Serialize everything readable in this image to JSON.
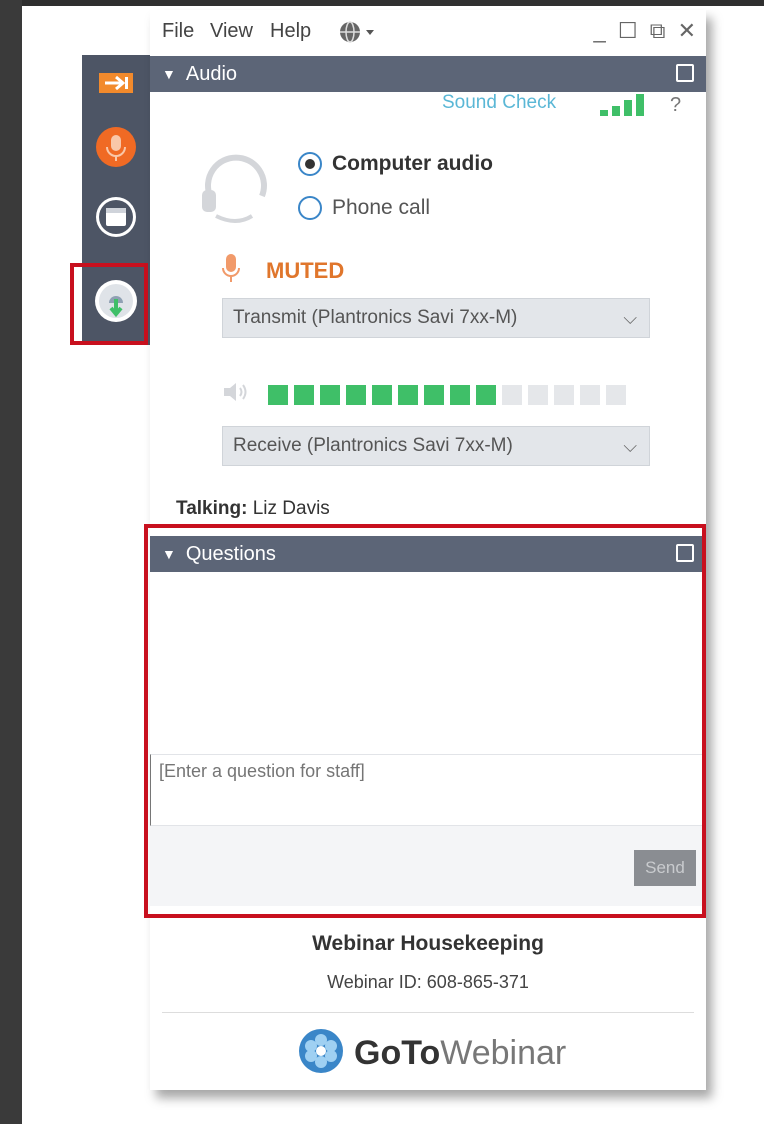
{
  "menu": {
    "file": "File",
    "view": "View",
    "help": "Help",
    "language_icon": "globe-icon"
  },
  "window_controls": {
    "minimize": "_",
    "restore": "☐",
    "popout": "⧉",
    "close": "✕"
  },
  "side_toolbar": {
    "items": [
      {
        "icon": "expand-arrow-icon"
      },
      {
        "icon": "microphone-icon",
        "color": "#f06a24"
      },
      {
        "icon": "calendar-icon"
      },
      {
        "icon": "question-download-icon",
        "highlighted": true
      }
    ],
    "highlight_color": "#c8101e"
  },
  "audio": {
    "header": "Audio",
    "sound_check": "Sound Check",
    "help": "?",
    "options": {
      "computer": "Computer audio",
      "phone": "Phone call",
      "selected": "computer"
    },
    "status": "MUTED",
    "status_color": "#e0762c",
    "transmit_device": "Transmit (Plantronics Savi 7xx-M)",
    "receive_device": "Receive (Plantronics Savi 7xx-M)",
    "volume_level_segments": 9,
    "volume_total_segments": 14
  },
  "talking": {
    "label": "Talking:",
    "name": "Liz Davis"
  },
  "questions": {
    "header": "Questions",
    "input_placeholder": "[Enter a question for staff]",
    "send_label": "Send"
  },
  "webinar": {
    "title": "Webinar Housekeeping",
    "id_text": "Webinar ID: 608-865-371"
  },
  "brand": {
    "goto": "GoTo",
    "webinar": "Webinar",
    "logo_color": "#3a86c8"
  }
}
